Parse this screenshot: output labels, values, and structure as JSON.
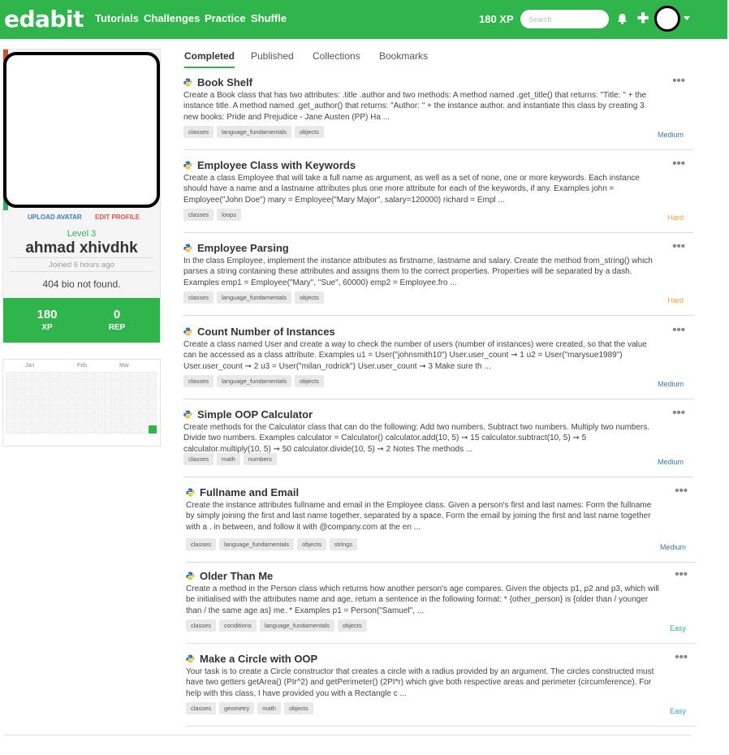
{
  "header": {
    "logo": "edabit",
    "nav": [
      "Tutorials",
      "Challenges",
      "Practice",
      "Shuffle"
    ],
    "xp": "180 XP",
    "search_placeholder": "Search"
  },
  "profile": {
    "upload_avatar": "Upload Avatar",
    "edit_profile": "Edit Profile",
    "level": "Level 3",
    "name": "ahmad xhivdhk",
    "joined": "Joined 6 hours ago",
    "bio": "404 bio not found.",
    "xp_value": "180",
    "xp_label": "XP",
    "rep_value": "0",
    "rep_label": "REP"
  },
  "heatmap": {
    "months": [
      "Jan",
      "Feb",
      "Mar"
    ]
  },
  "tabs": [
    "Completed",
    "Published",
    "Collections",
    "Bookmarks"
  ],
  "challenges": [
    {
      "title": "Book Shelf",
      "description": "Create a Book class that has two attributes: .title .author and two methods: A method named .get_title() that returns: \"Title: \" + the instance title. A method named .get_author() that returns: \"Author: \" + the instance author. and instantiate this class by creating 3 new books: Pride and Prejudice - Jane Austen (PP) Ha ...",
      "tags": [
        "classes",
        "language_fundamentals",
        "objects"
      ],
      "difficulty": "Medium"
    },
    {
      "title": "Employee Class with Keywords",
      "description": "Create a class Employee that will take a full name as argument, as well as a set of none, one or more keywords. Each instance should have a name and a lastname attributes plus one more attribute for each of the keywords, if any. Examples john = Employee(\"John Doe\") mary = Employee(\"Mary Major\", salary=120000) richard = Empl ...",
      "tags": [
        "classes",
        "loops"
      ],
      "difficulty": "Hard"
    },
    {
      "title": "Employee Parsing",
      "description": "In the class Employee, implement the instance attributes as firstname, lastname and salary. Create the method from_string() which parses a string containing these attributes and assigns them to the correct properties. Properties will be separated by a dash. Examples emp1 = Employee(\"Mary\", \"Sue\", 60000) emp2 = Employee.fro ...",
      "tags": [
        "classes",
        "language_fundamentals",
        "objects"
      ],
      "difficulty": "Hard"
    },
    {
      "title": "Count Number of Instances",
      "description": "Create a class named User and create a way to check the number of users (number of instances) were created, so that the value can be accessed as a class attribute. Examples u1 = User(\"johnsmith10\") User.user_count ➞ 1 u2 = User(\"marysue1989\") User.user_count ➞ 2 u3 = User(\"milan_rodrick\") User.user_count ➞ 3 Make sure th ...",
      "tags": [
        "classes",
        "language_fundamentals",
        "objects"
      ],
      "difficulty": "Medium"
    },
    {
      "title": "Simple OOP Calculator",
      "description": "Create methods for the Calculator class that can do the following: Add two numbers. Subtract two numbers. Multiply two numbers. Divide two numbers. Examples calculator = Calculator() calculator.add(10, 5) ➞ 15 calculator.subtract(10, 5) ➞ 5 calculator.multiply(10, 5) ➞ 50 calculator.divide(10, 5) ➞ 2 Notes The methods ...",
      "tags": [
        "classes",
        "math",
        "numbers"
      ],
      "difficulty": "Medium"
    },
    {
      "title": "Fullname and Email",
      "description": "Create the instance attributes fullname and email in the Employee class. Given a person's first and last names: Form the fullname by simply joining the first and last name together, separated by a space. Form the email by joining the first and last name together with a . in between, and follow it with @company.com at the en ...",
      "tags": [
        "classes",
        "language_fundamentals",
        "objects",
        "strings"
      ],
      "difficulty": "Medium"
    },
    {
      "title": "Older Than Me",
      "description": "Create a method in the Person class which returns how another person's age compares. Given the objects p1, p2 and p3, which will be initialised with the attributes name and age, return a sentence in the following format: * {other_person} is {older than / younger than / the same age as} me. * Examples p1 = Person(\"Samuel\", ...",
      "tags": [
        "classes",
        "conditions",
        "language_fundamentals",
        "objects"
      ],
      "difficulty": "Easy"
    },
    {
      "title": "Make a Circle with OOP",
      "description": "Your task is to create a Circle constructor that creates a circle with a radius provided by an argument. The circles constructed must have two getters getArea() (PIr^2) and getPerimeter() (2PI*r) which give both respective areas and perimeter (circumference). For help with this class, I have provided you with a Rectangle c ...",
      "tags": [
        "classes",
        "geometry",
        "math",
        "objects"
      ],
      "difficulty": "Easy"
    }
  ]
}
